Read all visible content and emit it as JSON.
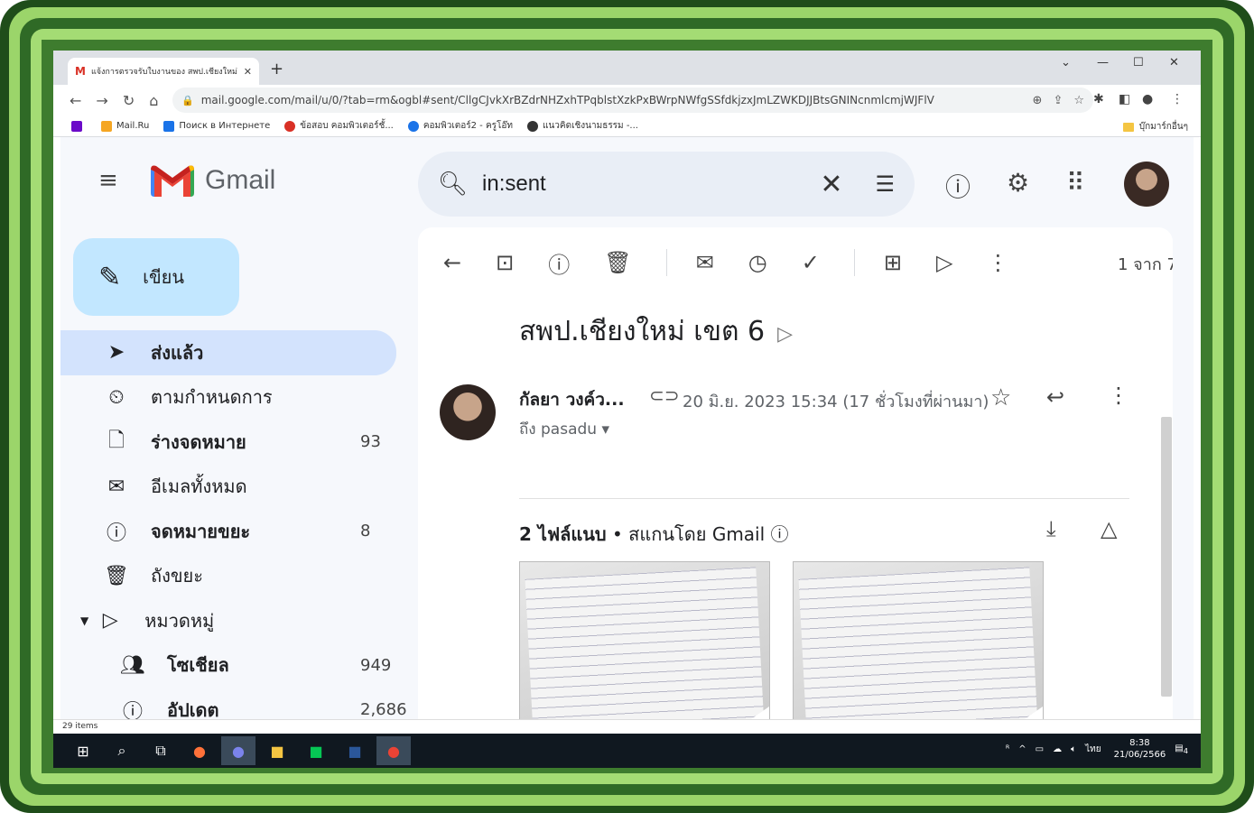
{
  "browser": {
    "tab_title": "แจ้งการตรวจรับใบงานของ สพป.เชียงใหม่",
    "url": "mail.google.com/mail/u/0/?tab=rm&ogbl#sent/CllgCJvkXrBZdrNHZxhTPqblstXzkPxBWrpNWfgSSfdkjzxJmLZWKDJJBtsGNINcnmlcmjWJFlV",
    "bookmarks": [
      "Mail.Ru",
      "Поиск в Интернете",
      "ข้อสอบ คอมพิวเตอร์ชั้...",
      "คอมพิวเตอร์2 - ครูโอ๊ท",
      "แนวคิดเชิงนามธรรม -..."
    ],
    "bookmarks_right": "บุ๊กมาร์กอื่นๆ"
  },
  "gmail": {
    "brand": "Gmail",
    "search_value": "in:sent",
    "compose_label": "เขียน",
    "nav": [
      {
        "label": "ส่งแล้ว",
        "count": ""
      },
      {
        "label": "ตามกำหนดการ",
        "count": ""
      },
      {
        "label": "ร่างจดหมาย",
        "count": "93"
      },
      {
        "label": "อีเมลทั้งหมด",
        "count": ""
      },
      {
        "label": "จดหมายขยะ",
        "count": "8"
      },
      {
        "label": "ถังขยะ",
        "count": ""
      },
      {
        "label": "หมวดหมู่",
        "count": ""
      },
      {
        "label": "โซเชียล",
        "count": "949"
      },
      {
        "label": "อัปเดต",
        "count": "2,686"
      }
    ],
    "pager": "1 จาก 7",
    "message": {
      "subject": "สพป.เชียงใหม่ เขต 6",
      "sender": "กัลยา วงค์ว...",
      "date": "20 มิ.ย. 2023 15:34 (17 ชั่วโมงที่ผ่านมา)",
      "to": "ถึง pasadu",
      "attachments_title": "2 ไฟล์แนบ",
      "attachments_note": "• สแกนโดย Gmail"
    }
  },
  "status": {
    "items": "29 items"
  },
  "taskbar": {
    "time": "8:38",
    "date": "21/06/2566",
    "lang": "ไทย",
    "notif": "4"
  }
}
